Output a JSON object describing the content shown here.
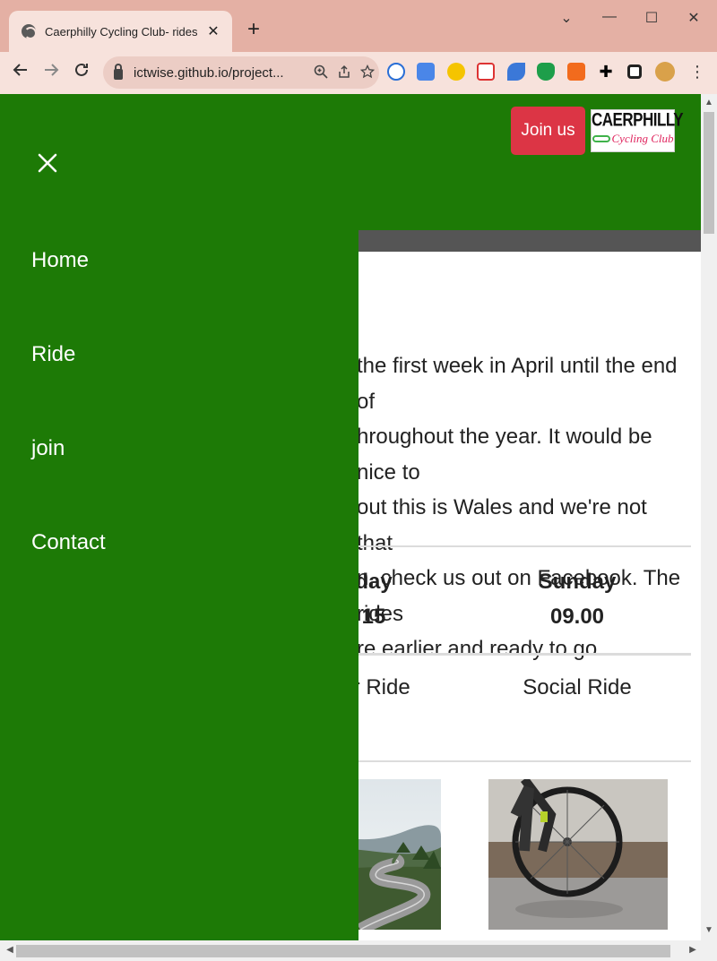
{
  "browser": {
    "tab_title": "Caerphilly Cycling Club- rides",
    "tab_close": "✕",
    "new_tab": "+",
    "url": "ictwise.github.io/project...",
    "window_controls": {
      "dropdown": "⌄",
      "minimize": "—",
      "maximize": "☐",
      "close": "✕"
    },
    "icons": [
      "back-icon",
      "forward-icon",
      "reload-icon",
      "lock-icon",
      "zoom-icon",
      "share-icon",
      "star-icon",
      "extensions-icon",
      "sidebar-icon",
      "profile-icon",
      "menu-icon"
    ]
  },
  "header": {
    "join_label": "Join us",
    "logo_line1": "CAERPHILLY",
    "logo_line2": "Cycling Club",
    "brand_color": "#1d7a06",
    "accent_color": "#dc3545"
  },
  "sidebar": {
    "close_icon": "close-icon",
    "items": [
      {
        "label": "Home"
      },
      {
        "label": "Ride"
      },
      {
        "label": "join"
      },
      {
        "label": "Contact"
      }
    ]
  },
  "content": {
    "intro_lines": [
      "the first week in April until the end of",
      "hroughout the year. It would be nice to",
      "out this is Wales and we're not that",
      "n, check us out on Facebook. The rides",
      "re earlier and ready to go."
    ],
    "schedule": [
      {
        "day": "day",
        "time": "15",
        "type": "er Ride"
      },
      {
        "day": "Sunday",
        "time": "09.00",
        "type": "Social Ride"
      }
    ]
  }
}
